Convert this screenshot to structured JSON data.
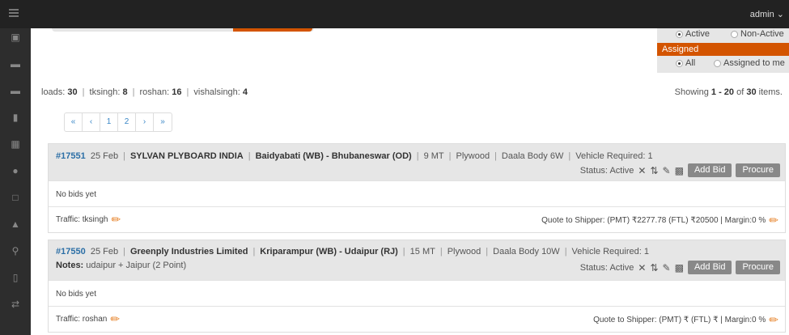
{
  "header": {
    "user": "admin",
    "user_caret": "⌄"
  },
  "sidebar": {
    "icons": [
      "truck-icon",
      "truck-icon",
      "truck-moving-icon",
      "chart-icon",
      "report-icon",
      "person-icon",
      "document-icon",
      "money-bag-icon",
      "search-icon",
      "columns-icon",
      "arrows-icon"
    ]
  },
  "filters": {
    "status_active": "Active",
    "status_inactive": "Non-Active",
    "assigned_label": "Assigned",
    "assigned_all": "All",
    "assigned_me": "Assigned to me"
  },
  "counts": [
    {
      "label": "loads:",
      "value": "30"
    },
    {
      "label": "tksingh:",
      "value": "8"
    },
    {
      "label": "roshan:",
      "value": "16"
    },
    {
      "label": "vishalsingh:",
      "value": "4"
    }
  ],
  "showing": {
    "prefix": "Showing",
    "range": "1 - 20",
    "mid": "of",
    "total": "30",
    "suffix": "items."
  },
  "pager": [
    "«",
    "‹",
    "1",
    "2",
    "›",
    "»"
  ],
  "loads": [
    {
      "id": "#17551",
      "date": "25 Feb",
      "company": "SYLVAN PLYBOARD INDIA",
      "route": "Baidyabati (WB) - Bhubaneswar (OD)",
      "weight": "9 MT",
      "material": "Plywood",
      "vehicle": "Daala Body 6W",
      "required": "Vehicle Required: 1",
      "notes_label": "",
      "notes": "",
      "status": "Status: Active",
      "add_bid": "Add Bid",
      "procure": "Procure",
      "bids": "No bids yet",
      "traffic": "Traffic: tksingh",
      "quote": "Quote to Shipper: (PMT) ₹2277.78 (FTL) ₹20500 | Margin:0 %"
    },
    {
      "id": "#17550",
      "date": "25 Feb",
      "company": "Greenply Industries Limited",
      "route": "Kriparampur (WB) - Udaipur (RJ)",
      "weight": "15 MT",
      "material": "Plywood",
      "vehicle": "Daala Body 10W",
      "required": "Vehicle Required: 1",
      "notes_label": "Notes:",
      "notes": "udaipur + Jaipur (2 Point)",
      "status": "Status: Active",
      "add_bid": "Add Bid",
      "procure": "Procure",
      "bids": "No bids yet",
      "traffic": "Traffic: roshan",
      "quote": "Quote to Shipper: (PMT) ₹ (FTL) ₹ | Margin:0 %"
    }
  ]
}
